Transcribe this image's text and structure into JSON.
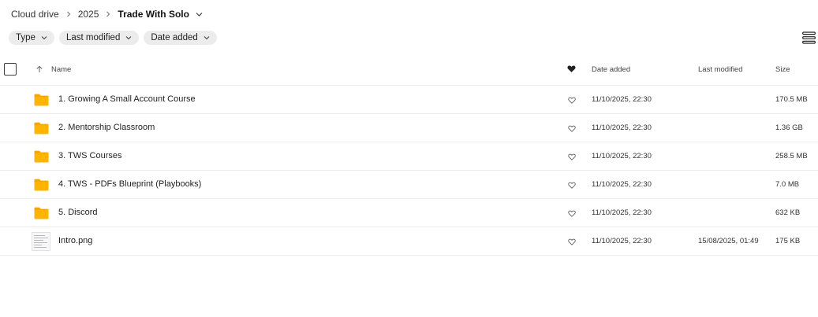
{
  "breadcrumb": {
    "items": [
      "Cloud drive",
      "2025"
    ],
    "current": "Trade With Solo"
  },
  "filters": [
    {
      "label": "Type"
    },
    {
      "label": "Last modified"
    },
    {
      "label": "Date added"
    }
  ],
  "table": {
    "columns": {
      "name": "Name",
      "date_added": "Date added",
      "last_modified": "Last modified",
      "size": "Size"
    },
    "rows": [
      {
        "type": "folder",
        "name": "1. Growing A Small Account Course",
        "date_added": "11/10/2025, 22:30",
        "last_modified": "",
        "size": "170.5 MB"
      },
      {
        "type": "folder",
        "name": "2. Mentorship Classroom",
        "date_added": "11/10/2025, 22:30",
        "last_modified": "",
        "size": "1.36 GB"
      },
      {
        "type": "folder",
        "name": "3. TWS Courses",
        "date_added": "11/10/2025, 22:30",
        "last_modified": "",
        "size": "258.5 MB"
      },
      {
        "type": "folder",
        "name": "4. TWS - PDFs Blueprint (Playbooks)",
        "date_added": "11/10/2025, 22:30",
        "last_modified": "",
        "size": "7.0 MB"
      },
      {
        "type": "folder",
        "name": "5. Discord",
        "date_added": "11/10/2025, 22:30",
        "last_modified": "",
        "size": "632 KB"
      },
      {
        "type": "image",
        "name": "Intro.png",
        "date_added": "11/10/2025, 22:30",
        "last_modified": "15/08/2025, 01:49",
        "size": "175 KB"
      }
    ]
  },
  "icons": {
    "folder": "folder-icon",
    "image": "image-thumbnail",
    "favourite": "heart-outline-icon",
    "favourite_header": "heart-filled-icon",
    "sort": "arrow-up-icon",
    "view": "list-view-icon"
  },
  "colors": {
    "folder": "#ffb400",
    "folder_tab": "#f6a600",
    "chip_bg": "#ececec",
    "divider": "#ebebeb"
  }
}
